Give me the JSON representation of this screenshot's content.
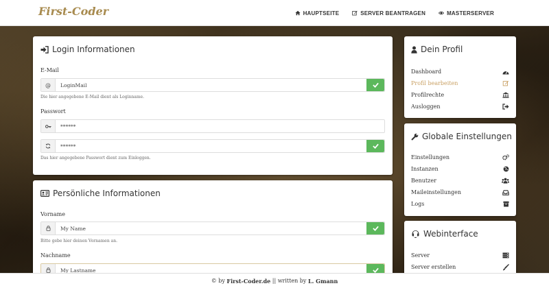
{
  "brand": "First-Coder",
  "nav": {
    "hauptseite": "HAUPTSEITE",
    "server_beantragen": "SERVER BEANTRAGEN",
    "masterserver": "MASTERSERVER"
  },
  "login": {
    "title": "Login Informationen",
    "email_label": "E-Mail",
    "email_value": "LoginMail",
    "email_help": "Die hier angegebene E-Mail dient als Loginname.",
    "password_label": "Passwort",
    "password_value": "******",
    "password_repeat_value": "******",
    "password_help": "Das hier angegebene Passwort dient zum Einloggen."
  },
  "personal": {
    "title": "Persönliche Informationen",
    "firstname_label": "Vorname",
    "firstname_value": "My Name",
    "firstname_help": "Bitte gebe hier deinen Vornamen an.",
    "lastname_label": "Nachname",
    "lastname_value": "My Lastname"
  },
  "profile": {
    "title": "Dein Profil",
    "items": [
      "Dashboard",
      "Profil bearbeiten",
      "Profilrechte",
      "Ausloggen"
    ]
  },
  "global": {
    "title": "Globale Einstellungen",
    "items": [
      "Einstellungen",
      "Instanzen",
      "Benutzer",
      "Maileinstellungen",
      "Logs"
    ]
  },
  "web": {
    "title": "Webinterface",
    "items": [
      "Server",
      "Server erstellen"
    ]
  },
  "footer": {
    "prefix": "© by",
    "site": "First-Coder.de",
    "middle": "|| written by",
    "author": "L. Gmann"
  },
  "colors": {
    "accent": "#a88b4f",
    "active_link": "#c9a063",
    "success": "#5cb85c"
  }
}
